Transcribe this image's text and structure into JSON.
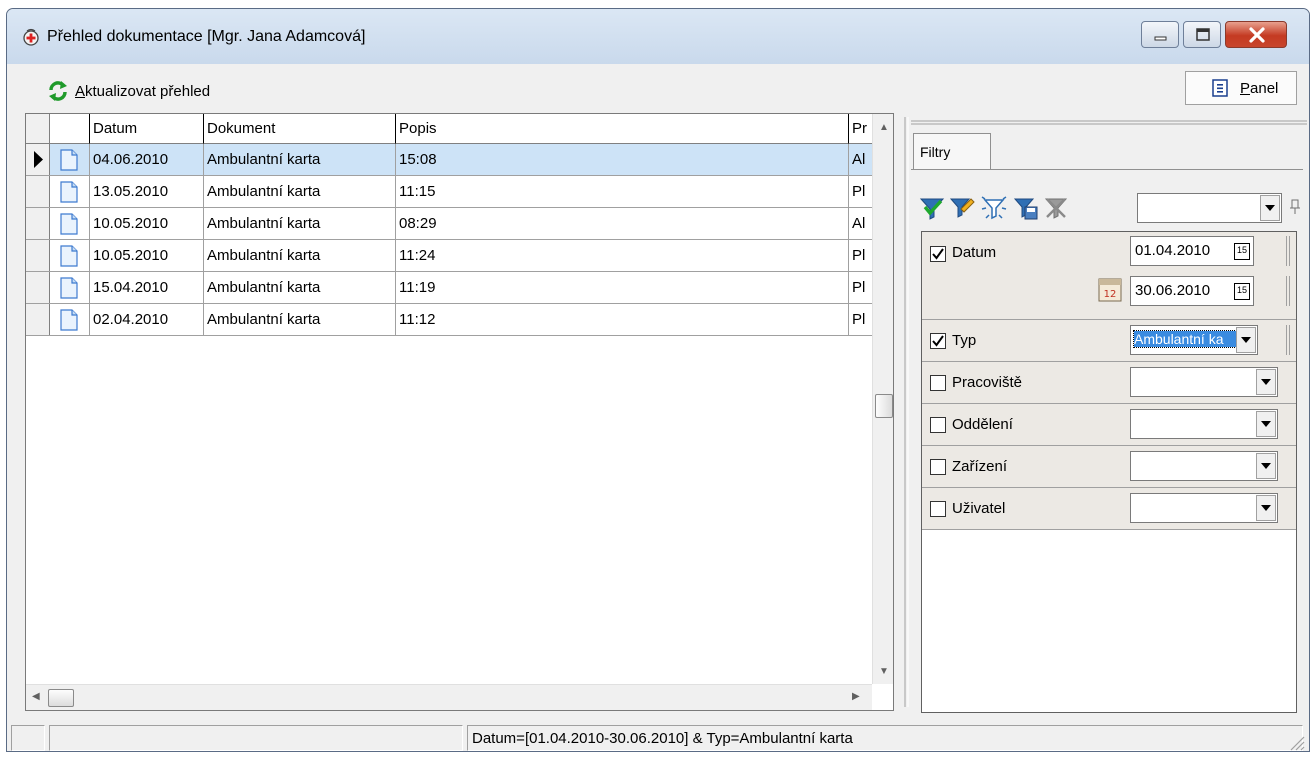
{
  "window": {
    "title": "Přehled dokumentace [Mgr. Jana Adamcová]"
  },
  "toolbar": {
    "refresh_label": "Aktualizovat přehled",
    "panel_label": "Panel"
  },
  "grid": {
    "columns": [
      "Datum",
      "Dokument",
      "Popis",
      "Pr"
    ],
    "rows": [
      {
        "datum": "04.06.2010",
        "dokument": "Ambulantní karta",
        "popis": "15:08",
        "p": "Al"
      },
      {
        "datum": "13.05.2010",
        "dokument": "Ambulantní karta",
        "popis": "11:15",
        "p": "Pl"
      },
      {
        "datum": "10.05.2010",
        "dokument": "Ambulantní karta",
        "popis": "08:29",
        "p": "Al"
      },
      {
        "datum": "10.05.2010",
        "dokument": "Ambulantní karta",
        "popis": "11:24",
        "p": "Pl"
      },
      {
        "datum": "15.04.2010",
        "dokument": "Ambulantní karta",
        "popis": "11:19",
        "p": "Pl"
      },
      {
        "datum": "02.04.2010",
        "dokument": "Ambulantní karta",
        "popis": "11:12",
        "p": "Pl"
      }
    ]
  },
  "panel": {
    "tab_label": "Filtry",
    "filters": {
      "datum": {
        "label": "Datum",
        "checked": true,
        "from": "01.04.2010",
        "to": "30.06.2010"
      },
      "typ": {
        "label": "Typ",
        "checked": true,
        "value": "Ambulantní ka"
      },
      "pracoviste": {
        "label": "Pracoviště",
        "checked": false,
        "value": ""
      },
      "oddeleni": {
        "label": "Oddělení",
        "checked": false,
        "value": ""
      },
      "zarizeni": {
        "label": "Zařízení",
        "checked": false,
        "value": ""
      },
      "uzivatel": {
        "label": "Uživatel",
        "checked": false,
        "value": ""
      }
    },
    "calendar_day": "15",
    "calendar_btn_day": "12"
  },
  "statusbar": {
    "filter_text": "Datum=[01.04.2010-30.06.2010] & Typ=Ambulantní karta"
  },
  "colors": {
    "selected_row": "#cde3f7",
    "focused_select": "#3a8be0",
    "close_button": "#c43a22"
  }
}
